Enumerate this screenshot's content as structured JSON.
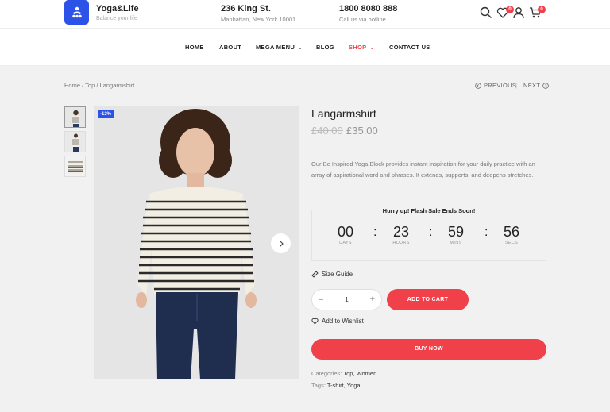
{
  "header": {
    "brand_name": "Yoga&Life",
    "brand_tagline": "Balance your life",
    "address_title": "236 King St.",
    "address_sub": "Manhattan, New York 10001",
    "phone_title": "1800 8080 888",
    "phone_sub": "Call us via hotline",
    "wishlist_count": "0",
    "cart_count": "0"
  },
  "nav": {
    "items": [
      {
        "label": "HOME"
      },
      {
        "label": "ABOUT"
      },
      {
        "label": "MEGA MENU"
      },
      {
        "label": "BLOG"
      },
      {
        "label": "SHOP"
      },
      {
        "label": "CONTACT US"
      }
    ]
  },
  "breadcrumb": {
    "home": "Home",
    "category": "Top",
    "current": "Langarmshirt",
    "sep": "/"
  },
  "pager": {
    "previous": "PREVIOUS",
    "divider": "|",
    "next": "NEXT"
  },
  "product": {
    "sale_badge": "-13%",
    "title": "Langarmshirt",
    "price_old": "£40.00",
    "price_new": "£35.00",
    "description": "Our Be Inspired Yoga Block provides instant inspiration for your daily practice with an array of aspirational word and phrases. It extends, supports, and deepens stretches.",
    "size_guide": "Size Guide",
    "quantity": "1",
    "add_to_cart": "ADD TO CART",
    "wishlist": "Add to Wishlist",
    "buy_now": "BUY NOW",
    "categories_label": "Categories:",
    "categories_value": "Top, Women",
    "tags_label": "Tags:",
    "tags_value": "T-shirt, Yoga"
  },
  "countdown": {
    "title": "Hurry up! Flash Sale Ends Soon!",
    "days": "00",
    "days_label": "DAYS",
    "hours": "23",
    "hours_label": "HOURS",
    "mins": "59",
    "mins_label": "MINS",
    "secs": "56",
    "secs_label": "SECS",
    "separator": ":"
  },
  "colors": {
    "accent": "#f0404a",
    "brand": "#2c52e8"
  }
}
